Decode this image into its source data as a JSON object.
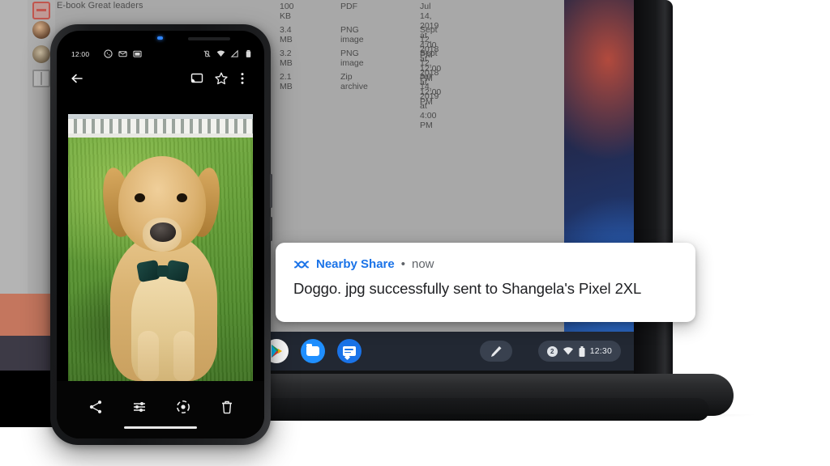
{
  "files_window": {
    "title": "E-book Great leaders",
    "rail_icons": [
      "pdf-doc-icon",
      "avatar-1",
      "avatar-2",
      "book-icon"
    ],
    "rows": [
      {
        "size": "100 KB",
        "type": "PDF",
        "date": "Jul 14, 2019 at 4:00 PM"
      },
      {
        "size": "3.4 MB",
        "type": "PNG image",
        "date": "Sept 12, 2018 at 12:00 PM"
      },
      {
        "size": "3.2 MB",
        "type": "PNG image",
        "date": "Sept 12, 2018 at 12:00 PM"
      },
      {
        "size": "2.1 MB",
        "type": "Zip archive",
        "date": "Jul 14, 2019 at 4:00 PM"
      }
    ]
  },
  "phone": {
    "status_bar": {
      "time": "12:00",
      "left_icons": [
        "whatsapp-icon",
        "email-icon",
        "screenshot-icon"
      ],
      "right_icons": [
        "vibrate-off-icon",
        "wifi-icon",
        "signal-icon",
        "battery-icon"
      ]
    },
    "toolbar": {
      "back_label": "back-arrow-icon",
      "cast_label": "cast-icon",
      "star_label": "star-icon",
      "more_label": "more-vert-icon"
    },
    "photo": {
      "subject": "golden-retriever-with-bow-tie",
      "alt": "Doggo. jpg"
    },
    "bottom_bar": {
      "actions": [
        "share-icon",
        "edit-sliders-icon",
        "lens-icon",
        "delete-icon"
      ]
    }
  },
  "shelf": {
    "apps": [
      {
        "name": "play-store",
        "label": "Play Store"
      },
      {
        "name": "files",
        "label": "Files"
      },
      {
        "name": "messages",
        "label": "Messages"
      }
    ],
    "stylus": "stylus-pen-icon",
    "tray": {
      "account_badge": "2",
      "wifi": "wifi-icon",
      "battery": "battery-icon",
      "time": "12:30"
    }
  },
  "notification": {
    "icon": "nearby-share-icon",
    "app_name": "Nearby Share",
    "separator": "•",
    "time": "now",
    "message": "Doggo. jpg successfully sent to Shangela's Pixel 2XL"
  },
  "colors": {
    "accent_blue": "#1a73e8",
    "shelf_bg": "#222833",
    "window_grey": "#a8a8a8",
    "notif_bg": "#ffffff"
  }
}
